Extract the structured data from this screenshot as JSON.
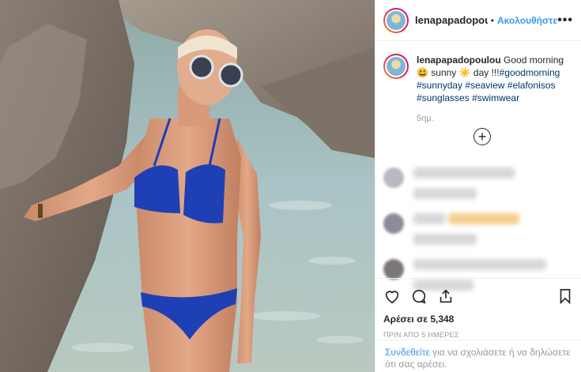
{
  "post": {
    "username": "lenapapadopoulou",
    "follow_label": "Ακολουθήστε",
    "more_label": "•••",
    "dot": "•",
    "caption_user": "lenapapadopoulou",
    "caption_text": " Good morning 😃 sunny ☀️ day !!!",
    "hashtags": [
      "#goodmorning",
      "#sunnyday",
      "#seaview",
      "#elafonisos",
      "#sunglasses",
      "#swimwear"
    ],
    "age": "5ημ.",
    "load_more": "+"
  },
  "actions": {
    "like_icon": "heart-icon",
    "comment_icon": "comment-icon",
    "share_icon": "share-icon",
    "save_icon": "bookmark-icon",
    "likes": "Αρέσει σε 5,348",
    "date": "ΠΡΙΝ ΑΠΟ 5 ΗΜΕΡΕΣ"
  },
  "login": {
    "link": "Συνδεθείτε",
    "text": " για να σχολιάσετε ή να δηλώσετε ότι σας αρέσει."
  },
  "colors": {
    "link": "#3897f0",
    "hashtag": "#003569",
    "muted": "#999999"
  }
}
